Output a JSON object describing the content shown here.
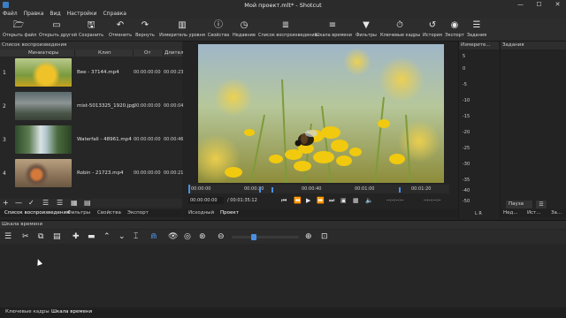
{
  "window": {
    "title": "Мой проект.mlt* - Shotcut",
    "min": "—",
    "max": "☐",
    "close": "✕"
  },
  "menu": [
    "Файл",
    "Правка",
    "Вид",
    "Настройки",
    "Справка"
  ],
  "toolbar": [
    {
      "label": "Открыть файл",
      "icon": "open-file-icon",
      "glyph": "🗁"
    },
    {
      "label": "Открыть другой",
      "icon": "open-other-icon",
      "glyph": "▭"
    },
    {
      "label": "Сохранить",
      "icon": "save-icon",
      "glyph": "🖫"
    },
    {
      "label": "Отменить",
      "icon": "undo-icon",
      "glyph": "↶"
    },
    {
      "label": "Вернуть",
      "icon": "redo-icon",
      "glyph": "↷"
    },
    {
      "label": "Измеритель уровня",
      "icon": "audio-meter-icon",
      "glyph": "▥"
    },
    {
      "label": "Свойства",
      "icon": "properties-icon",
      "glyph": "ⓘ"
    },
    {
      "label": "Недавние",
      "icon": "recent-icon",
      "glyph": "◷"
    },
    {
      "label": "Список воспроизведения",
      "icon": "playlist-icon",
      "glyph": "≣"
    },
    {
      "label": "Шкала времени",
      "icon": "timeline-icon",
      "glyph": "≡"
    },
    {
      "label": "Фильтры",
      "icon": "filters-icon",
      "glyph": "▼"
    },
    {
      "label": "Ключевые кадры",
      "icon": "keyframes-icon",
      "glyph": "⏱"
    },
    {
      "label": "История",
      "icon": "history-icon",
      "glyph": "↺"
    },
    {
      "label": "Экспорт",
      "icon": "export-icon",
      "glyph": "◉"
    },
    {
      "label": "Задания",
      "icon": "jobs-icon",
      "glyph": "☰"
    }
  ],
  "playlist": {
    "title": "Список воспроизведения",
    "columns": {
      "thumbs": "Миниатюры",
      "clip": "Клип",
      "in": "От",
      "duration": "Длител"
    },
    "rows": [
      {
        "num": "1",
        "clip": "Bee - 37144.mp4",
        "in": "00:00:00:00",
        "dur": "00:00:23"
      },
      {
        "num": "2",
        "clip": "mist-5013325_1920.jpg",
        "in": "00:00:00:00",
        "dur": "00:00:04"
      },
      {
        "num": "3",
        "clip": "Waterfall - 48961.mp4",
        "in": "00:00:00:00",
        "dur": "00:00:46"
      },
      {
        "num": "4",
        "clip": "Robin - 21723.mp4",
        "in": "00:00:00:00",
        "dur": "00:00:21"
      }
    ],
    "tools": [
      "+",
      "—",
      "✓",
      "☰",
      "☰",
      "▦",
      "▤"
    ],
    "tabs": [
      "Список воспроизведения",
      "Фильтры",
      "Свойства",
      "Экспорт"
    ]
  },
  "player": {
    "ruler": [
      "00:00:00",
      "00:00:20",
      "00:00:40",
      "00:01:00",
      "00:01:20"
    ],
    "timecode": "00:00:00:00",
    "total": "/ 00:01:35:12",
    "in_point": "--:--:--:--",
    "out_point": "--:--:--:--",
    "tabs": [
      "Исходный",
      "Проект"
    ]
  },
  "meter": {
    "title": "Измерите...",
    "scale": [
      "5",
      "0",
      "-5",
      "-10",
      "-15",
      "-20",
      "-25",
      "-30",
      "-35",
      "-40",
      "-50"
    ],
    "channels": "L R"
  },
  "jobs": {
    "title": "Задания",
    "pause": "Пауза",
    "menu": "☰",
    "tabs": [
      "Нед...",
      "Ист...",
      "За..."
    ]
  },
  "timeline": {
    "title": "Шкала времени"
  },
  "bottom_tabs": [
    "Ключевые кадры",
    "Шкала времени"
  ]
}
